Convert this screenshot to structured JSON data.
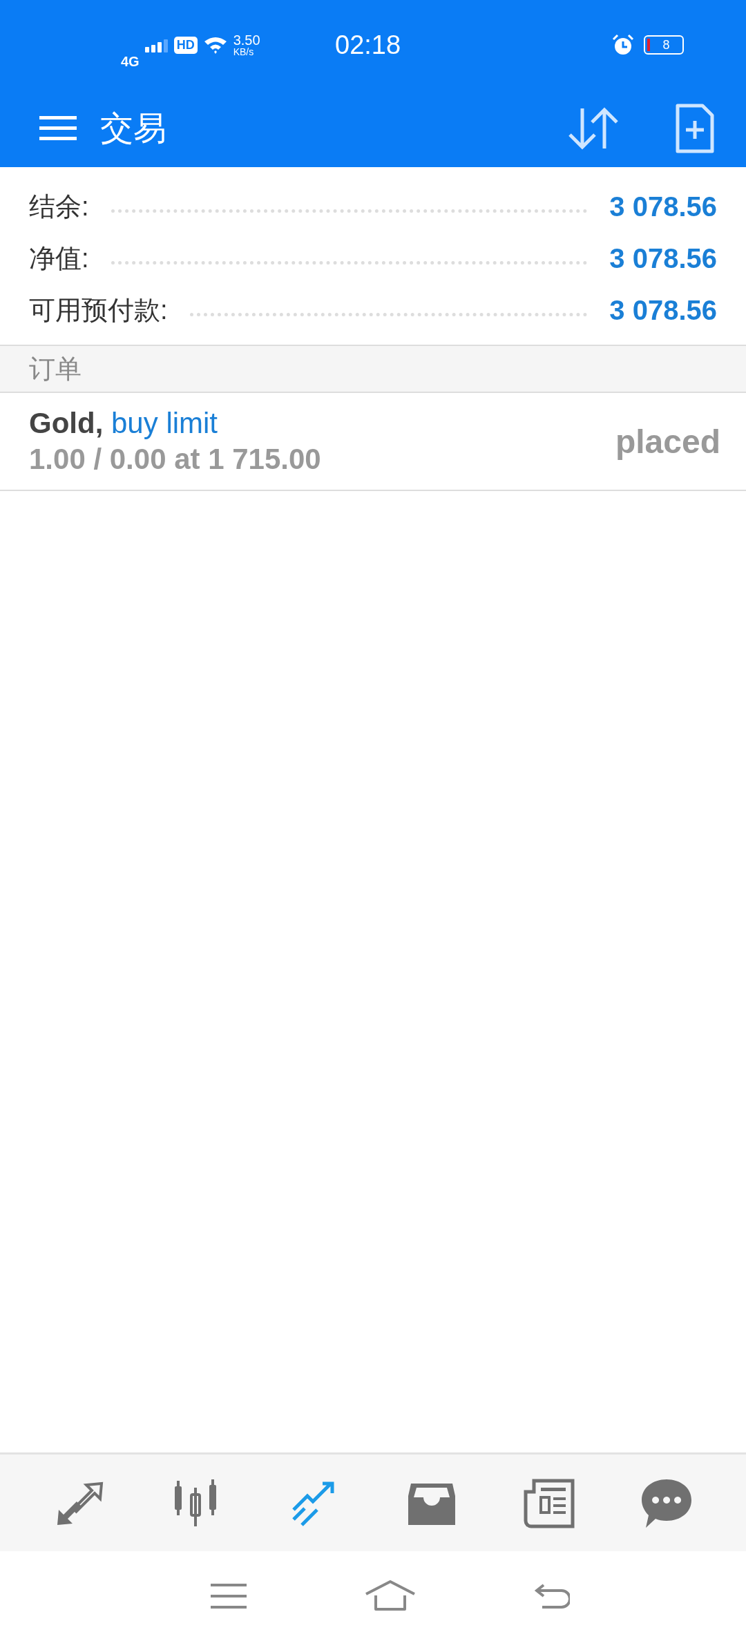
{
  "status_bar": {
    "network": "4G",
    "hd": "HD",
    "speed": "3.50",
    "speed_unit": "KB/s",
    "time": "02:18",
    "battery": "8"
  },
  "app_bar": {
    "title": "交易"
  },
  "summary": [
    {
      "label": "结余:",
      "value": "3 078.56"
    },
    {
      "label": "净值:",
      "value": "3 078.56"
    },
    {
      "label": "可用预付款:",
      "value": "3 078.56"
    }
  ],
  "section": {
    "title": "订单"
  },
  "orders": [
    {
      "symbol": "Gold,",
      "type": "buy limit",
      "details": "1.00 / 0.00 at 1 715.00",
      "status": "placed"
    }
  ],
  "bottom_nav": [
    {
      "kind": "quotes",
      "selected": false
    },
    {
      "kind": "chart",
      "selected": false
    },
    {
      "kind": "trade",
      "selected": true
    },
    {
      "kind": "history",
      "selected": false
    },
    {
      "kind": "news",
      "selected": false
    },
    {
      "kind": "chat",
      "selected": false
    }
  ]
}
